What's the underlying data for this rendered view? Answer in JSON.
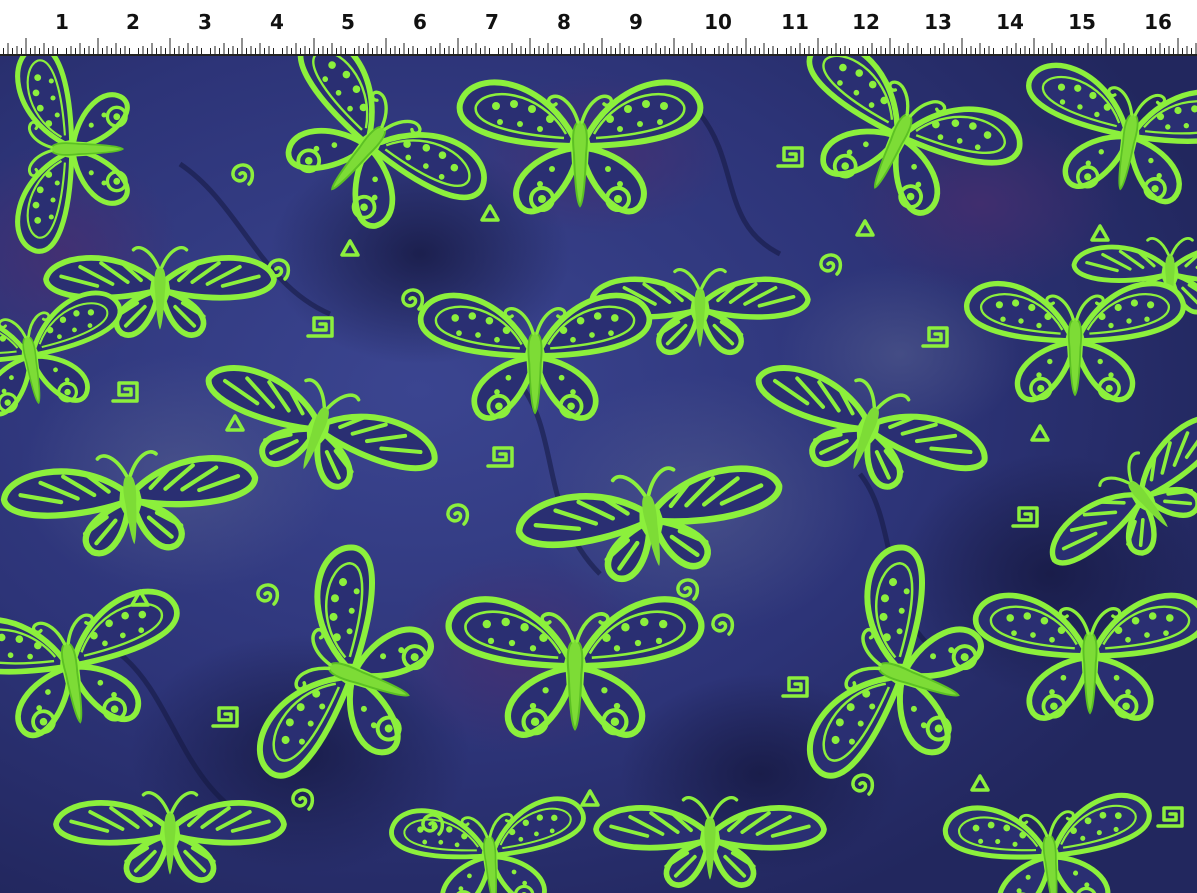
{
  "ruler": {
    "numbers": [
      "1",
      "2",
      "3",
      "4",
      "5",
      "6",
      "7",
      "8",
      "9",
      "10",
      "11",
      "12",
      "13",
      "14",
      "15",
      "16"
    ]
  },
  "fabric": {
    "description_colors": {
      "background": "#2d3478",
      "background_dark": "#1a1c4a",
      "purple_tint": "#4a2d6e",
      "motif": "#8cf03c",
      "motif_dark": "#4fb81e"
    },
    "motif_icon": "butterfly-icon",
    "accent_icon": "spiral-icon"
  }
}
